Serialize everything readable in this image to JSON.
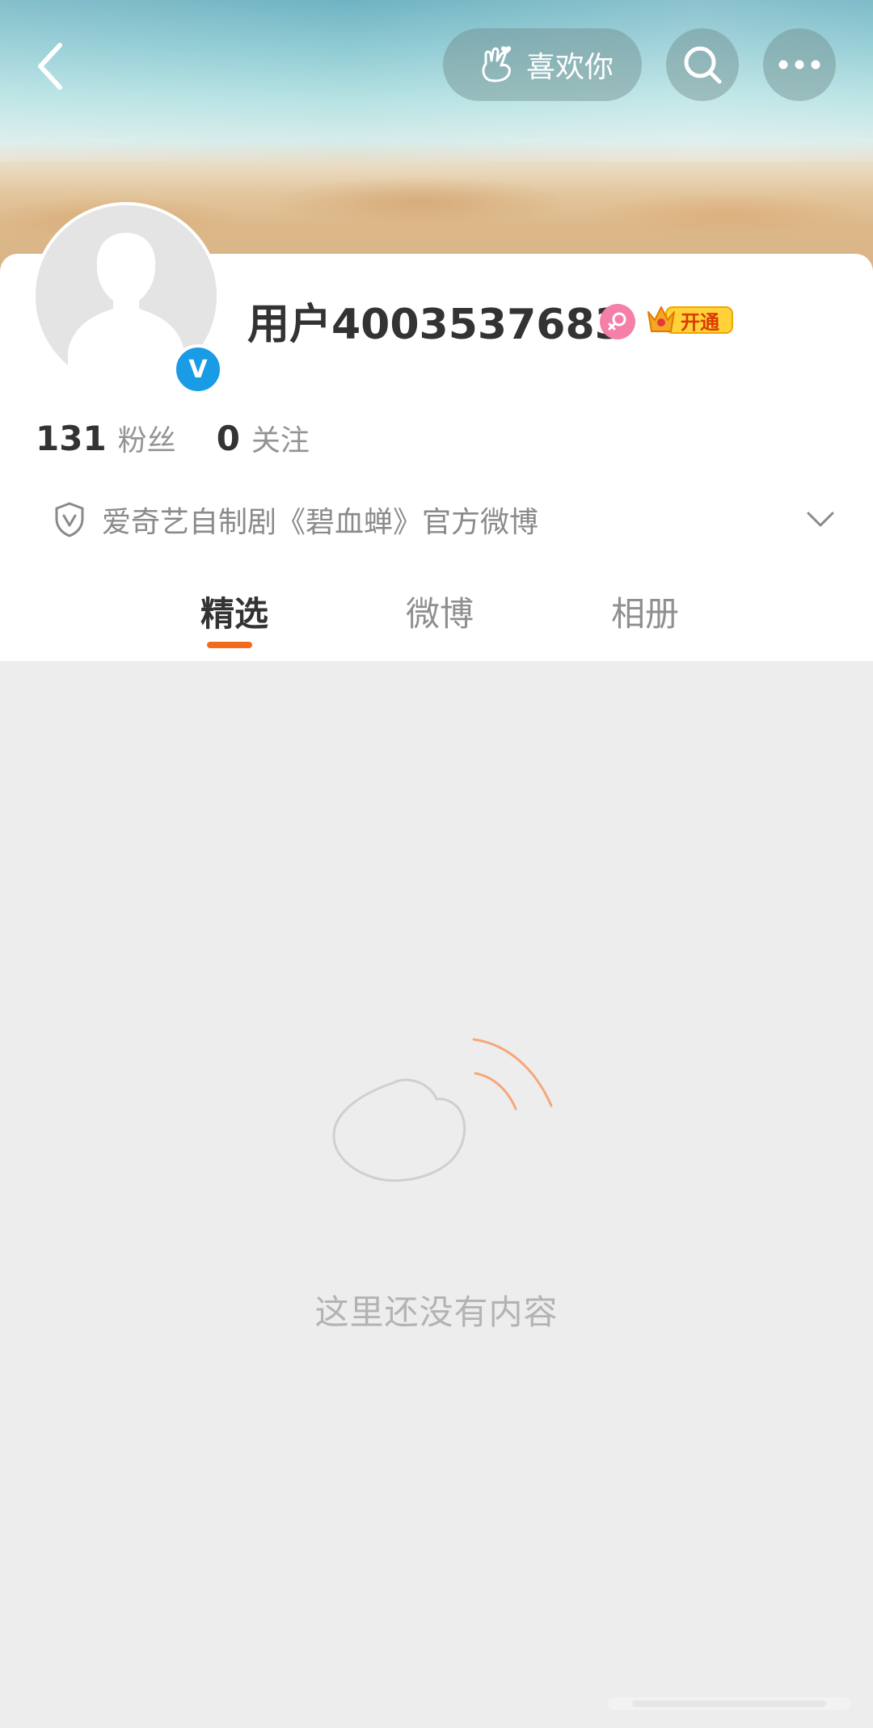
{
  "header": {
    "back_icon": "chevron-left-icon",
    "like_button_label": "喜欢你",
    "like_icon": "hand-heart-icon",
    "search_icon": "search-icon",
    "more_icon": "more-dots-icon"
  },
  "profile": {
    "username": "用户4003537683",
    "verified": true,
    "verified_badge": "V",
    "gender_icon": "female-icon",
    "vip_badge_label": "开通",
    "followers_count": "131",
    "followers_label": "粉丝",
    "following_count": "0",
    "following_label": "关注",
    "bio": "爱奇艺自制剧《碧血蝉》官方微博"
  },
  "tabs": [
    {
      "label": "精选",
      "active": true
    },
    {
      "label": "微博",
      "active": false
    },
    {
      "label": "相册",
      "active": false
    }
  ],
  "empty_state": {
    "message": "这里还没有内容"
  },
  "colors": {
    "accent": "#f26b1d",
    "verified_blue": "#1a9be6",
    "gender_pink": "#f47fa8",
    "background": "#ededed"
  }
}
